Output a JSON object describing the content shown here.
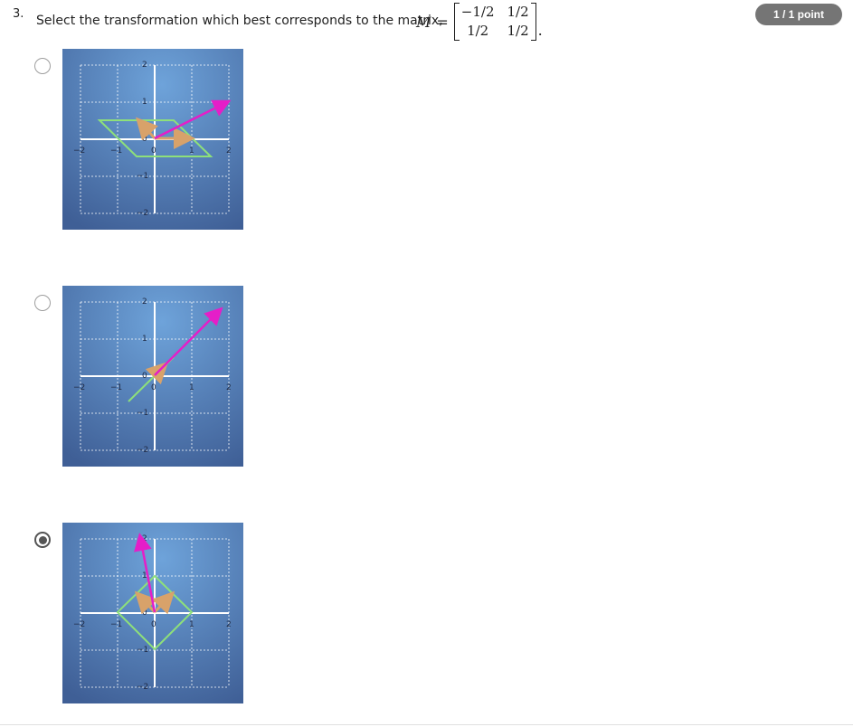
{
  "question": {
    "number": "3.",
    "text": "Select the transformation which best corresponds to the matrix,",
    "matrix_name": "M",
    "equals": "=",
    "matrix": [
      [
        "−1/2",
        "1/2"
      ],
      [
        "1/2",
        "1/2"
      ]
    ],
    "trailing": "."
  },
  "score_badge": "1 / 1 point",
  "options": [
    {
      "id": "option-1",
      "selected": false,
      "axis_ticks": [
        "−2",
        "−1",
        "0",
        "1",
        "2"
      ]
    },
    {
      "id": "option-2",
      "selected": false,
      "axis_ticks": [
        "−2",
        "−1",
        "0",
        "1",
        "2"
      ]
    },
    {
      "id": "option-3",
      "selected": true,
      "axis_ticks": [
        "−2",
        "−1",
        "0",
        "1",
        "2"
      ]
    }
  ],
  "colors": {
    "shape": "#8ee07a",
    "basis_vectors": "#d8a26a",
    "magenta_vector": "#e51ec8",
    "plot_bg_center": "#6b9fd6",
    "plot_bg_edge": "#3f5f96",
    "badge_bg": "#757575"
  }
}
